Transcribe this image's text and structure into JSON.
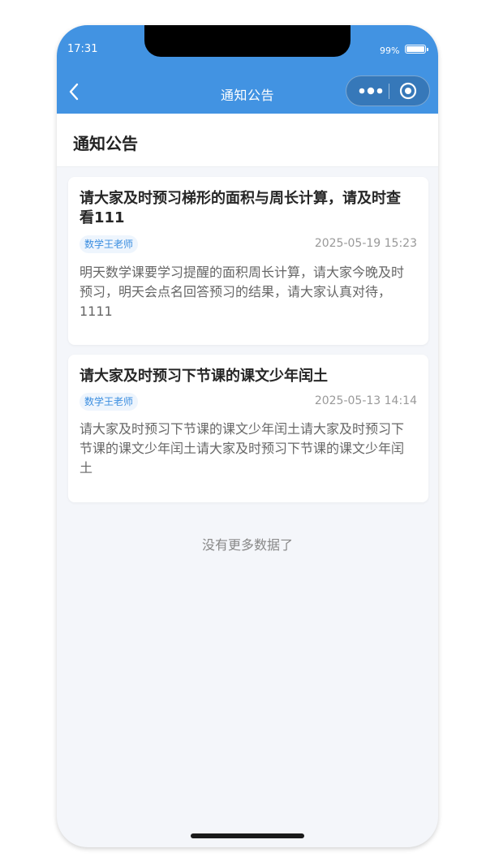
{
  "status_bar": {
    "time": "17:31",
    "battery": "99%"
  },
  "nav_bar": {
    "title": "通知公告",
    "back_icon": "chevron-left-icon",
    "more_icon": "more-dots-icon",
    "close_icon": "target-close-icon"
  },
  "page": {
    "title": "通知公告"
  },
  "notices": [
    {
      "title": "请大家及时预习梯形的面积与周长计算，请及时查看111",
      "author": "数学王老师",
      "date": "2025-05-19 15:23",
      "content": "明天数学课要学习提醒的面积周长计算，请大家今晚及时预习，明天会点名回答预习的结果，请大家认真对待，1111"
    },
    {
      "title": "请大家及时预习下节课的课文少年闰土",
      "author": "数学王老师",
      "date": "2025-05-13 14:14",
      "content": "请大家及时预习下节课的课文少年闰土请大家及时预习下节课的课文少年闰土请大家及时预习下节课的课文少年闰土"
    }
  ],
  "footer": {
    "no_more": "没有更多数据了"
  },
  "colors": {
    "primary": "#4293e2",
    "tag_text": "#3b8ee0",
    "tag_bg": "#eef5fd",
    "background": "#f4f6fa"
  }
}
